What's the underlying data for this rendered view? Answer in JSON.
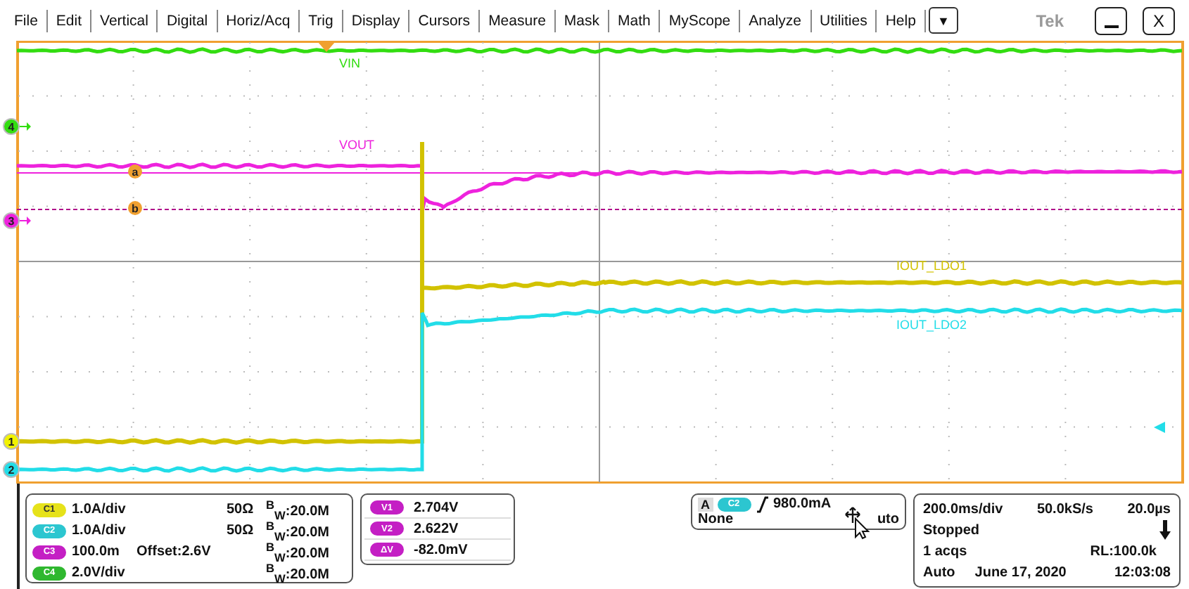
{
  "menu": [
    "File",
    "Edit",
    "Vertical",
    "Digital",
    "Horiz/Acq",
    "Trig",
    "Display",
    "Cursors",
    "Measure",
    "Mask",
    "Math",
    "MyScope",
    "Analyze",
    "Utilities",
    "Help"
  ],
  "menu_dropdown": "▼",
  "brand": "Tek",
  "close_button": "X",
  "traces": [
    {
      "label": "VIN",
      "color": "#33dd11"
    },
    {
      "label": "VOUT",
      "color": "#ee22dd"
    },
    {
      "label": "IOUT_LDO1",
      "color": "#d2c200"
    },
    {
      "label": "IOUT_LDO2",
      "color": "#22dde8"
    }
  ],
  "channel_markers": [
    {
      "label": "4",
      "color": "#33dd11"
    },
    {
      "label": "3",
      "color": "#ee22dd"
    },
    {
      "label": "1",
      "color": "#f2f200"
    },
    {
      "label": "2",
      "color": "#22dde8"
    }
  ],
  "cursor_markers": [
    "a",
    "b"
  ],
  "channels": [
    {
      "badge": "C1",
      "color": "#e6e21a",
      "scale": "1.0A/div",
      "impedance": "50Ω",
      "bandwidth": "$^{B}$$_{W}$:20.0M"
    },
    {
      "badge": "C2",
      "color": "#2cc6d0",
      "scale": "1.0A/div",
      "impedance": "50Ω",
      "bandwidth": "$^{B}$$_{W}$:20.0M"
    },
    {
      "badge": "C3",
      "color": "#c41fc4",
      "scale": "100.0m",
      "offset": "Offset:2.6V",
      "bandwidth": "$^{B}$$_{W}$:20.0M"
    },
    {
      "badge": "C4",
      "color": "#2fb82f",
      "scale": "2.0V/div",
      "bandwidth": "$^{B}$$_{W}$:20.0M"
    }
  ],
  "cursor_readouts": [
    {
      "badge": "V1",
      "value": "2.704V"
    },
    {
      "badge": "V2",
      "value": "2.622V"
    },
    {
      "badge": "ΔV",
      "value": "-82.0mV"
    }
  ],
  "trigger": {
    "type": "A",
    "source": "C2",
    "color": "#2cc6d0",
    "level": "980.0mA",
    "coupling": "None",
    "mode": "uto"
  },
  "acquisition": {
    "timebase": "200.0ms/div",
    "sample_rate": "50.0kS/s",
    "position": "20.0µs",
    "state": "Stopped",
    "count": "1 acqs",
    "record_length": "RL:100.0k",
    "mode": "Auto",
    "date": "June 17, 2020",
    "time": "12:03:08"
  }
}
